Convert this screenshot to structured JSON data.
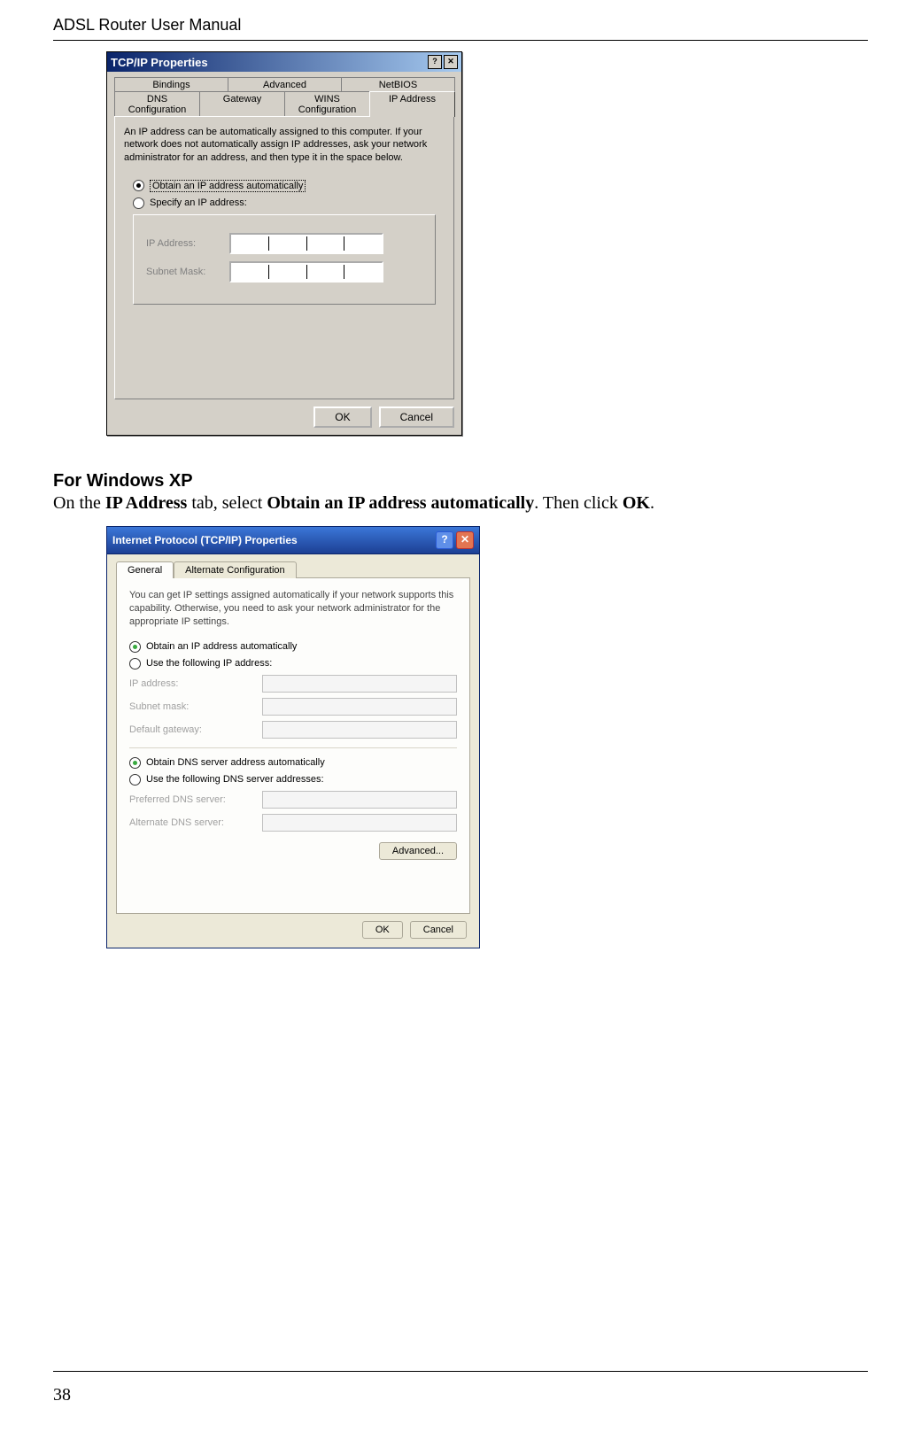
{
  "header": {
    "title": "ADSL Router User Manual"
  },
  "footer": {
    "page_number": "38"
  },
  "win98": {
    "title": "TCP/IP Properties",
    "close_glyph": "✕",
    "help_glyph": "?",
    "tabs_row1": [
      "Bindings",
      "Advanced",
      "NetBIOS"
    ],
    "tabs_row2": [
      "DNS Configuration",
      "Gateway",
      "WINS Configuration",
      "IP Address"
    ],
    "active_tab": "IP Address",
    "description": "An IP address can be automatically assigned to this computer. If your network does not automatically assign IP addresses, ask your network administrator for an address, and then type it in the space below.",
    "radio_auto": "Obtain an IP address automatically",
    "radio_specify": "Specify an IP address:",
    "ip_label": "IP Address:",
    "subnet_label": "Subnet Mask:",
    "ok": "OK",
    "cancel": "Cancel"
  },
  "section": {
    "heading": "For Windows XP",
    "text_pre": "On the ",
    "b1": "IP Address",
    "text_mid1": " tab, select ",
    "b2": "Obtain an IP address automatically",
    "text_mid2": ". Then click ",
    "b3": "OK",
    "text_post": "."
  },
  "winxp": {
    "title": "Internet Protocol (TCP/IP) Properties",
    "help_glyph": "?",
    "close_glyph": "✕",
    "tab_general": "General",
    "tab_alt": "Alternate Configuration",
    "description": "You can get IP settings assigned automatically if your network supports this capability. Otherwise, you need to ask your network administrator for the appropriate IP settings.",
    "radio_ip_auto": "Obtain an IP address automatically",
    "radio_ip_manual": "Use the following IP address:",
    "ip_label": "IP address:",
    "subnet_label": "Subnet mask:",
    "gateway_label": "Default gateway:",
    "radio_dns_auto": "Obtain DNS server address automatically",
    "radio_dns_manual": "Use the following DNS server addresses:",
    "pref_dns": "Preferred DNS server:",
    "alt_dns": "Alternate DNS server:",
    "advanced": "Advanced...",
    "ok": "OK",
    "cancel": "Cancel"
  }
}
